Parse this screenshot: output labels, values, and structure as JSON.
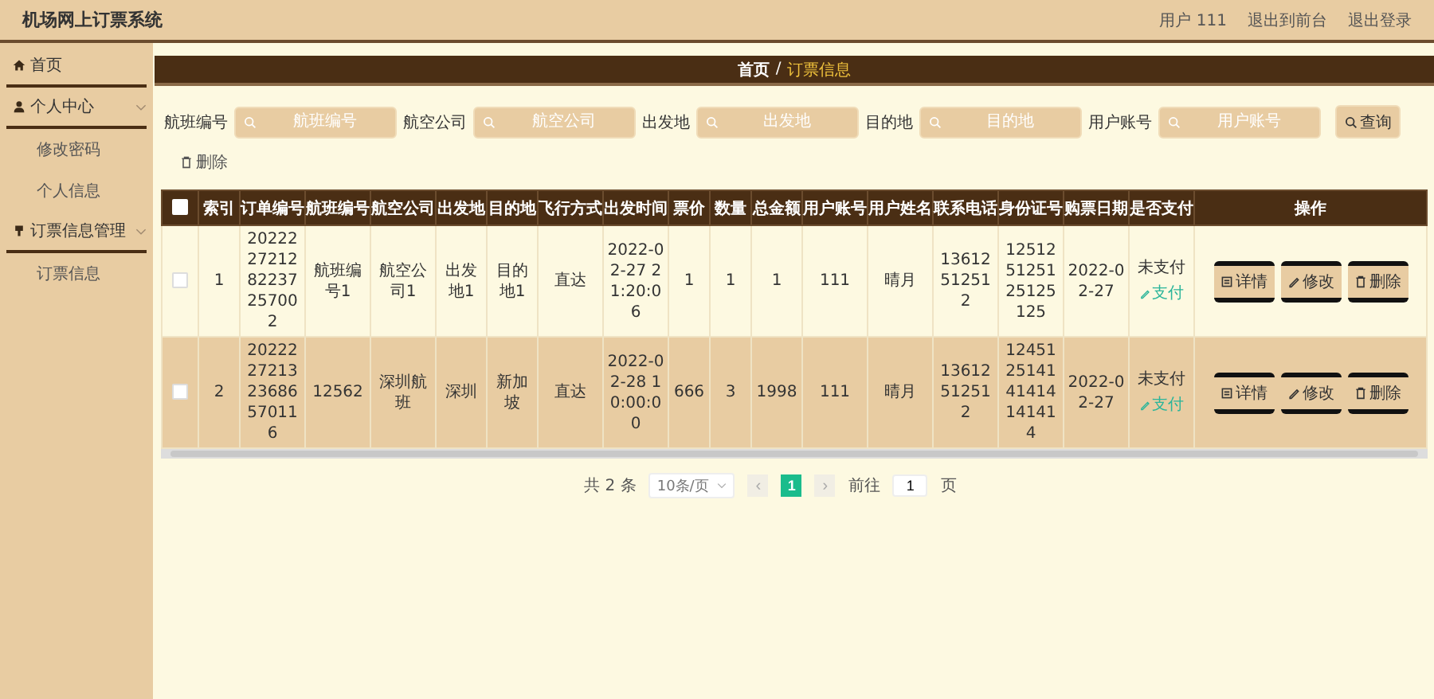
{
  "header": {
    "title": "机场网上订票系统",
    "user_label": "用户 111",
    "links": [
      "退出到前台",
      "退出登录"
    ]
  },
  "sidebar": {
    "items": [
      {
        "label": "首页"
      },
      {
        "label": "个人中心",
        "expanded": true,
        "children": [
          {
            "label": "修改密码"
          },
          {
            "label": "个人信息"
          }
        ]
      },
      {
        "label": "订票信息管理",
        "expanded": true,
        "children": [
          {
            "label": "订票信息"
          }
        ]
      }
    ]
  },
  "breadcrumb": [
    "首页",
    "订票信息"
  ],
  "breadcrumb_separator": "/",
  "search": {
    "fields": [
      {
        "label": "航班编号",
        "placeholder": "航班编号"
      },
      {
        "label": "航空公司",
        "placeholder": "航空公司"
      },
      {
        "label": "出发地",
        "placeholder": "出发地"
      },
      {
        "label": "目的地",
        "placeholder": "目的地"
      },
      {
        "label": "用户账号",
        "placeholder": "用户账号"
      }
    ],
    "button": "查询"
  },
  "delete_button": "删除",
  "table": {
    "select_all_checked": false,
    "columns": [
      "索引",
      "订单编号",
      "航班编号",
      "航空公司",
      "出发地",
      "目的地",
      "飞行方式",
      "出发时间",
      "票价",
      "数量",
      "总金额",
      "用户账号",
      "用户姓名",
      "联系电话",
      "身份证号",
      "购票日期",
      "是否支付",
      "操作"
    ],
    "rows": [
      {
        "selected": false,
        "hovered": false,
        "cells": [
          "1",
          "202222721282237257002",
          "航班编号1",
          "航空公司1",
          "出发地1",
          "目的地1",
          "直达",
          "2022-02-27 21:20:06",
          "1",
          "1",
          "1",
          "111",
          "晴月",
          "13612512512",
          "125125125125125125",
          "2022-02-27"
        ],
        "paid_status": "未支付",
        "pay_link": "支付",
        "actions": [
          "详情",
          "修改",
          "删除"
        ]
      },
      {
        "selected": false,
        "hovered": true,
        "cells": [
          "2",
          "202222721323686570116",
          "12562",
          "深圳航班",
          "深圳",
          "新加坡",
          "直达",
          "2022-02-28 10:00:00",
          "666",
          "3",
          "1998",
          "111",
          "晴月",
          "13612512512",
          "124512514141414141414",
          "2022-02-27"
        ],
        "paid_status": "未支付",
        "pay_link": "支付",
        "actions": [
          "详情",
          "修改",
          "删除"
        ]
      }
    ]
  },
  "pagination": {
    "total": "共 2 条",
    "page_size": "10条/页",
    "prev": "‹",
    "pages": [
      {
        "label": "1",
        "selected": true
      }
    ],
    "next": "›",
    "goto_label": "前往",
    "goto_value": "1",
    "page_unit": "页"
  }
}
